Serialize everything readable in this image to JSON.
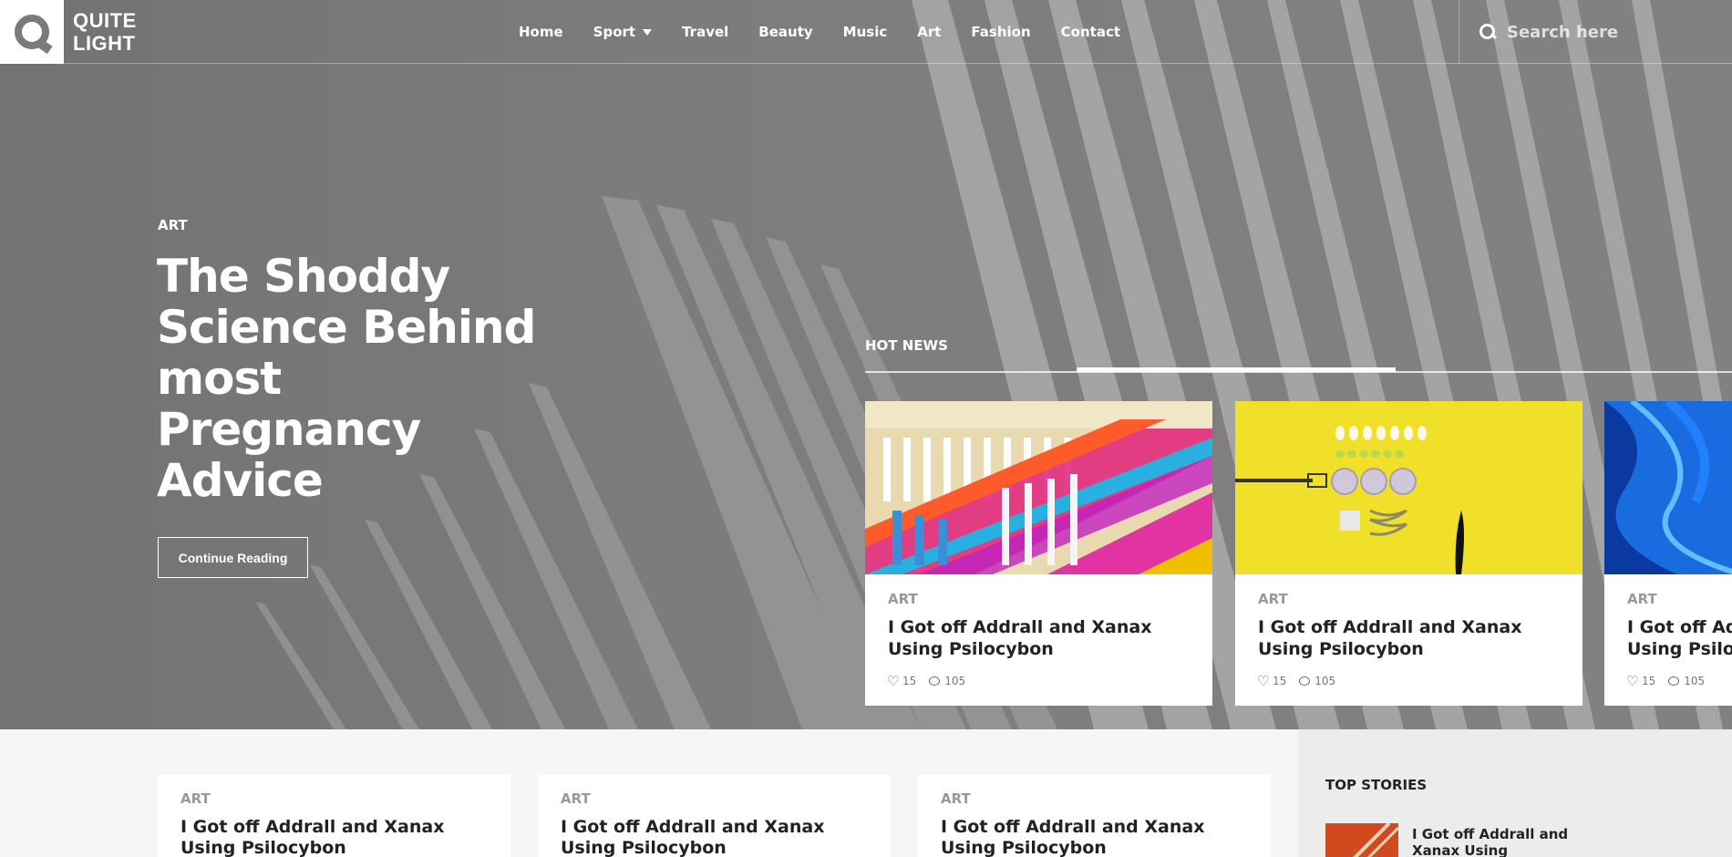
{
  "brand": {
    "logo_line1": "QUITE",
    "logo_line2": "LIGHT"
  },
  "nav": {
    "items": [
      "Home",
      "Sport",
      "Travel",
      "Beauty",
      "Music",
      "Art",
      "Fashion",
      "Contact"
    ]
  },
  "search": {
    "placeholder": "Search here"
  },
  "hero": {
    "category": "ART",
    "title": "The Shoddy Science Behind most Pregnancy Advice",
    "button": "Continue Reading"
  },
  "hot_news": {
    "label": "HOT NEWS",
    "cards": [
      {
        "category": "ART",
        "title": "I Got off Addrall and Xanax Using Psilocybon",
        "likes": "15",
        "comments": "105"
      },
      {
        "category": "ART",
        "title": "I Got off Addrall and Xanax Using Psilocybon",
        "likes": "15",
        "comments": "105"
      },
      {
        "category": "ART",
        "title": "I Got off Addrall and Xanax Using Psilocybon",
        "likes": "15",
        "comments": "105"
      }
    ]
  },
  "posts": [
    {
      "category": "ART",
      "title": "I Got off Addrall and Xanax Using Psilocybon"
    },
    {
      "category": "ART",
      "title": "I Got off Addrall and Xanax Using Psilocybon"
    },
    {
      "category": "ART",
      "title": "I Got off Addrall and Xanax Using Psilocybon"
    }
  ],
  "sidebar": {
    "heading": "TOP STORIES",
    "story_title": "I Got off Addrall and Xanax Using"
  },
  "colors": {
    "hero_bg": "#7a7a7a",
    "card_bg": "#ffffff",
    "accent_yellow": "#f2e024"
  }
}
